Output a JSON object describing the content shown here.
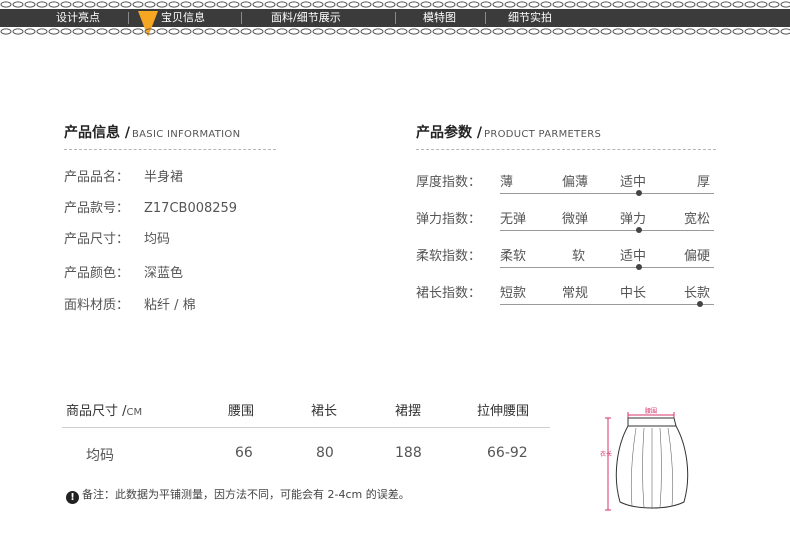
{
  "nav": {
    "items": [
      "设计亮点",
      "宝贝信息",
      "面料/细节展示",
      "模特图",
      "细节实拍"
    ],
    "active_index": 1,
    "active_color": "#f5a623"
  },
  "info": {
    "title": "产品信息 /",
    "subtitle": "BASIC INFORMATION",
    "rows": [
      {
        "label": "产品品名：",
        "value": "半身裙"
      },
      {
        "label": "产品款号：",
        "value": "Z17CB008259"
      },
      {
        "label": "产品尺寸：",
        "value": "均码"
      },
      {
        "label": "产品颜色：",
        "value": "深蓝色"
      },
      {
        "label": "面料材质：",
        "value": "粘纤 / 棉"
      }
    ]
  },
  "params": {
    "title": "产品参数 /",
    "subtitle": "PRODUCT PARMETERS",
    "rows": [
      {
        "label": "厚度指数：",
        "options": [
          "薄",
          "偏薄",
          "适中",
          "厚"
        ],
        "selected": 2
      },
      {
        "label": "弹力指数：",
        "options": [
          "无弹",
          "微弹",
          "弹力",
          "宽松"
        ],
        "selected": 2
      },
      {
        "label": "柔软指数：",
        "options": [
          "柔软",
          "软",
          "适中",
          "偏硬"
        ],
        "selected": 2
      },
      {
        "label": "裙长指数：",
        "options": [
          "短款",
          "常规",
          "中长",
          "长款"
        ],
        "selected": 3
      }
    ]
  },
  "size_table": {
    "header_label": "商品尺寸 /",
    "header_unit": "CM",
    "columns": [
      "腰围",
      "裙长",
      "裙摆",
      "拉伸腰围"
    ],
    "row": {
      "label": "均码",
      "values": [
        "66",
        "80",
        "188",
        "66-92"
      ]
    }
  },
  "note": {
    "icon": "exclamation-icon",
    "text": "备注：此数据为平铺测量，因方法不同，可能会有 2-4cm 的误差。"
  },
  "diagram": {
    "waist_label": "腰围",
    "length_label": "衣长",
    "measure_color": "#d6336c"
  }
}
